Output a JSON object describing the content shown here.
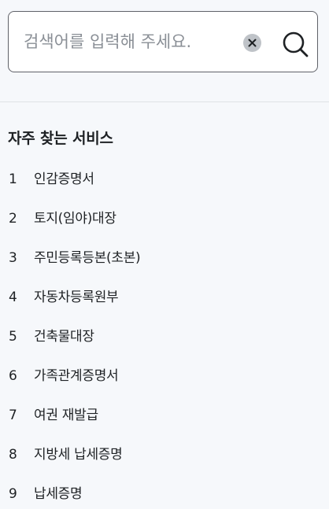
{
  "search": {
    "placeholder": "검색어를 입력해 주세요.",
    "value": "",
    "clear_icon": "close-circle-icon",
    "search_icon": "magnifier-icon"
  },
  "popular": {
    "title": "자주 찾는 서비스",
    "items": [
      {
        "num": "1",
        "label": "인감증명서"
      },
      {
        "num": "2",
        "label": "토지(임야)대장"
      },
      {
        "num": "3",
        "label": "주민등록등본(초본)"
      },
      {
        "num": "4",
        "label": "자동차등록원부"
      },
      {
        "num": "5",
        "label": "건축물대장"
      },
      {
        "num": "6",
        "label": "가족관계증명서"
      },
      {
        "num": "7",
        "label": "여권 재발급"
      },
      {
        "num": "8",
        "label": "지방세 납세증명"
      },
      {
        "num": "9",
        "label": "납세증명"
      }
    ]
  },
  "colors": {
    "background": "#f6f8fb",
    "text": "#1e2124",
    "border": "#5f6168",
    "clear_button": "#bfc3c8"
  }
}
